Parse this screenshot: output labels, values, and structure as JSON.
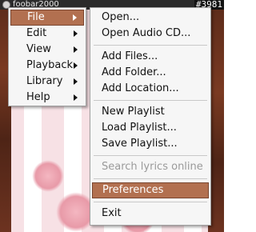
{
  "window": {
    "title": "foobar2000",
    "corner_badge": "#3981"
  },
  "main_menu": {
    "items": [
      {
        "label": "File",
        "has_submenu": true,
        "active": true
      },
      {
        "label": "Edit",
        "has_submenu": true
      },
      {
        "label": "View",
        "has_submenu": true
      },
      {
        "label": "Playback",
        "has_submenu": true
      },
      {
        "label": "Library",
        "has_submenu": true
      },
      {
        "label": "Help",
        "has_submenu": true
      }
    ]
  },
  "file_menu": {
    "items": [
      {
        "label": "Open..."
      },
      {
        "label": "Open Audio CD..."
      },
      {
        "label": "Add Files..."
      },
      {
        "label": "Add Folder..."
      },
      {
        "label": "Add Location..."
      },
      {
        "label": "New Playlist"
      },
      {
        "label": "Load Playlist..."
      },
      {
        "label": "Save Playlist..."
      },
      {
        "label": "Search lyrics online",
        "disabled": true
      },
      {
        "label": "Preferences",
        "highlighted": true
      },
      {
        "label": "Exit"
      }
    ]
  },
  "colors": {
    "highlight": "#b27050",
    "menu_bg": "#f6f6f6"
  }
}
